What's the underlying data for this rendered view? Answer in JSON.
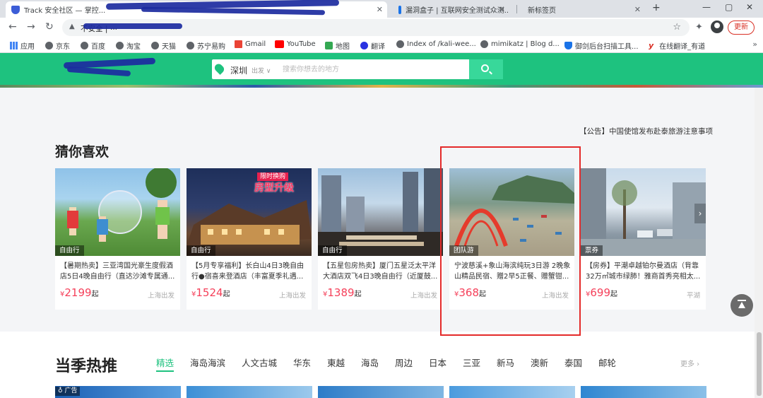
{
  "browser": {
    "tabs": [
      {
        "title": "Track 安全社区 — 掌控..."
      },
      {
        "title": "漏洞盒子 | 互联网安全测试众测..."
      },
      {
        "title": "新标签页"
      }
    ],
    "new_tab_label": "+",
    "address_prefix": "不安全 |",
    "address_text": "...",
    "update_button": "更新",
    "window_controls": [
      "—",
      "▢",
      "✕"
    ]
  },
  "bookmarks": [
    {
      "label": "应用",
      "icon": "apps-grid-icon"
    },
    {
      "label": "京东",
      "icon": "globe-icon"
    },
    {
      "label": "百度",
      "icon": "globe-icon"
    },
    {
      "label": "淘宝",
      "icon": "globe-icon"
    },
    {
      "label": "天猫",
      "icon": "globe-icon"
    },
    {
      "label": "苏宁易购",
      "icon": "globe-icon"
    },
    {
      "label": "Gmail",
      "icon": "gmail-icon"
    },
    {
      "label": "YouTube",
      "icon": "youtube-icon"
    },
    {
      "label": "地图",
      "icon": "maps-icon"
    },
    {
      "label": "翻译",
      "icon": "baidu-icon"
    },
    {
      "label": "Index of /kali-wee...",
      "icon": "globe-icon"
    },
    {
      "label": "mimikatz | Blog d...",
      "icon": "globe-icon"
    },
    {
      "label": "御剑后台扫描工具...",
      "icon": "shield-icon"
    },
    {
      "label": "在线翻译_有道",
      "icon": "youdao-icon"
    }
  ],
  "search": {
    "city": "深圳",
    "depart_label": "出发",
    "placeholder": "搜索你想去的地方"
  },
  "notice": "【公告】中国使馆发布赴泰旅游注意事项",
  "guess_section": {
    "title": "猜你喜欢",
    "cards": [
      {
        "badge": "自由行",
        "title": "【暑期热卖】三亚湾国光豪生度假酒店5日4晚自由行（直达沙滩专属通...",
        "currency": "¥",
        "price": "2199",
        "price_unit": "起",
        "depart": "上海出发"
      },
      {
        "badge": "自由行",
        "title": "【5月专享福利】长白山4日3晚自由行●宿喜来登酒店（丰富夏季礼遇...",
        "currency": "¥",
        "price": "1524",
        "price_unit": "起",
        "depart": "上海出发",
        "promo_top": "限时换购",
        "promo_main": "房型升级"
      },
      {
        "badge": "自由行",
        "title": "【五星包房热卖】厦门五星泛太平洋大酒店双飞4日3晚自由行（近厦鼓...",
        "currency": "¥",
        "price": "1389",
        "price_unit": "起",
        "depart": "上海出发"
      },
      {
        "badge": "团队游",
        "title": "宁波慈溪+象山海滨纯玩3日游 2晚象山精品民宿、赠2早5正餐、赠蟹钳...",
        "currency": "¥",
        "price": "368",
        "price_unit": "起",
        "depart": "上海出发"
      },
      {
        "badge": "票券",
        "title": "【房券】平潮卓越铂尔曼酒店（背靠32万㎡城市绿肺！雅商首秀亮相太...",
        "currency": "¥",
        "price": "699",
        "price_unit": "起",
        "depart": "平湖"
      }
    ]
  },
  "season_section": {
    "title": "当季热推",
    "tabs": [
      "精选",
      "海岛海滨",
      "人文古城",
      "华东",
      "東越",
      "海岛",
      "周边",
      "日本",
      "三亚",
      "新马",
      "澳新",
      "泰国",
      "邮轮"
    ],
    "more": "更多 ›",
    "ad_label": "广告"
  },
  "colors": {
    "brand_green": "#1ec27f",
    "price_red": "#f5405a",
    "highlight_box": "#e42a2a"
  }
}
